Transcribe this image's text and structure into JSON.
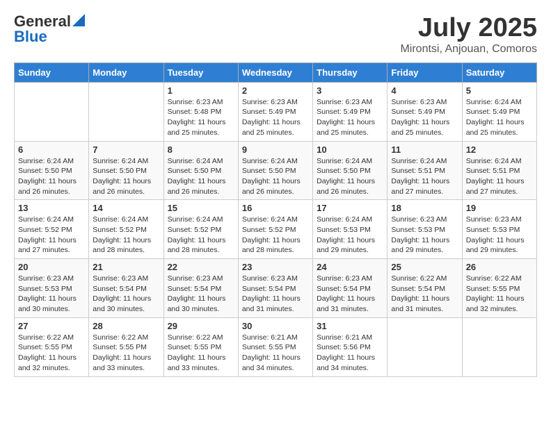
{
  "logo": {
    "general": "General",
    "blue": "Blue"
  },
  "title": "July 2025",
  "location": "Mirontsi, Anjouan, Comoros",
  "weekdays": [
    "Sunday",
    "Monday",
    "Tuesday",
    "Wednesday",
    "Thursday",
    "Friday",
    "Saturday"
  ],
  "weeks": [
    [
      {
        "day": "",
        "content": ""
      },
      {
        "day": "",
        "content": ""
      },
      {
        "day": "1",
        "content": "Sunrise: 6:23 AM\nSunset: 5:48 PM\nDaylight: 11 hours and 25 minutes."
      },
      {
        "day": "2",
        "content": "Sunrise: 6:23 AM\nSunset: 5:49 PM\nDaylight: 11 hours and 25 minutes."
      },
      {
        "day": "3",
        "content": "Sunrise: 6:23 AM\nSunset: 5:49 PM\nDaylight: 11 hours and 25 minutes."
      },
      {
        "day": "4",
        "content": "Sunrise: 6:23 AM\nSunset: 5:49 PM\nDaylight: 11 hours and 25 minutes."
      },
      {
        "day": "5",
        "content": "Sunrise: 6:24 AM\nSunset: 5:49 PM\nDaylight: 11 hours and 25 minutes."
      }
    ],
    [
      {
        "day": "6",
        "content": "Sunrise: 6:24 AM\nSunset: 5:50 PM\nDaylight: 11 hours and 26 minutes."
      },
      {
        "day": "7",
        "content": "Sunrise: 6:24 AM\nSunset: 5:50 PM\nDaylight: 11 hours and 26 minutes."
      },
      {
        "day": "8",
        "content": "Sunrise: 6:24 AM\nSunset: 5:50 PM\nDaylight: 11 hours and 26 minutes."
      },
      {
        "day": "9",
        "content": "Sunrise: 6:24 AM\nSunset: 5:50 PM\nDaylight: 11 hours and 26 minutes."
      },
      {
        "day": "10",
        "content": "Sunrise: 6:24 AM\nSunset: 5:50 PM\nDaylight: 11 hours and 26 minutes."
      },
      {
        "day": "11",
        "content": "Sunrise: 6:24 AM\nSunset: 5:51 PM\nDaylight: 11 hours and 27 minutes."
      },
      {
        "day": "12",
        "content": "Sunrise: 6:24 AM\nSunset: 5:51 PM\nDaylight: 11 hours and 27 minutes."
      }
    ],
    [
      {
        "day": "13",
        "content": "Sunrise: 6:24 AM\nSunset: 5:52 PM\nDaylight: 11 hours and 27 minutes."
      },
      {
        "day": "14",
        "content": "Sunrise: 6:24 AM\nSunset: 5:52 PM\nDaylight: 11 hours and 28 minutes."
      },
      {
        "day": "15",
        "content": "Sunrise: 6:24 AM\nSunset: 5:52 PM\nDaylight: 11 hours and 28 minutes."
      },
      {
        "day": "16",
        "content": "Sunrise: 6:24 AM\nSunset: 5:52 PM\nDaylight: 11 hours and 28 minutes."
      },
      {
        "day": "17",
        "content": "Sunrise: 6:24 AM\nSunset: 5:53 PM\nDaylight: 11 hours and 29 minutes."
      },
      {
        "day": "18",
        "content": "Sunrise: 6:23 AM\nSunset: 5:53 PM\nDaylight: 11 hours and 29 minutes."
      },
      {
        "day": "19",
        "content": "Sunrise: 6:23 AM\nSunset: 5:53 PM\nDaylight: 11 hours and 29 minutes."
      }
    ],
    [
      {
        "day": "20",
        "content": "Sunrise: 6:23 AM\nSunset: 5:53 PM\nDaylight: 11 hours and 30 minutes."
      },
      {
        "day": "21",
        "content": "Sunrise: 6:23 AM\nSunset: 5:54 PM\nDaylight: 11 hours and 30 minutes."
      },
      {
        "day": "22",
        "content": "Sunrise: 6:23 AM\nSunset: 5:54 PM\nDaylight: 11 hours and 30 minutes."
      },
      {
        "day": "23",
        "content": "Sunrise: 6:23 AM\nSunset: 5:54 PM\nDaylight: 11 hours and 31 minutes."
      },
      {
        "day": "24",
        "content": "Sunrise: 6:23 AM\nSunset: 5:54 PM\nDaylight: 11 hours and 31 minutes."
      },
      {
        "day": "25",
        "content": "Sunrise: 6:22 AM\nSunset: 5:54 PM\nDaylight: 11 hours and 31 minutes."
      },
      {
        "day": "26",
        "content": "Sunrise: 6:22 AM\nSunset: 5:55 PM\nDaylight: 11 hours and 32 minutes."
      }
    ],
    [
      {
        "day": "27",
        "content": "Sunrise: 6:22 AM\nSunset: 5:55 PM\nDaylight: 11 hours and 32 minutes."
      },
      {
        "day": "28",
        "content": "Sunrise: 6:22 AM\nSunset: 5:55 PM\nDaylight: 11 hours and 33 minutes."
      },
      {
        "day": "29",
        "content": "Sunrise: 6:22 AM\nSunset: 5:55 PM\nDaylight: 11 hours and 33 minutes."
      },
      {
        "day": "30",
        "content": "Sunrise: 6:21 AM\nSunset: 5:55 PM\nDaylight: 11 hours and 34 minutes."
      },
      {
        "day": "31",
        "content": "Sunrise: 6:21 AM\nSunset: 5:56 PM\nDaylight: 11 hours and 34 minutes."
      },
      {
        "day": "",
        "content": ""
      },
      {
        "day": "",
        "content": ""
      }
    ]
  ]
}
